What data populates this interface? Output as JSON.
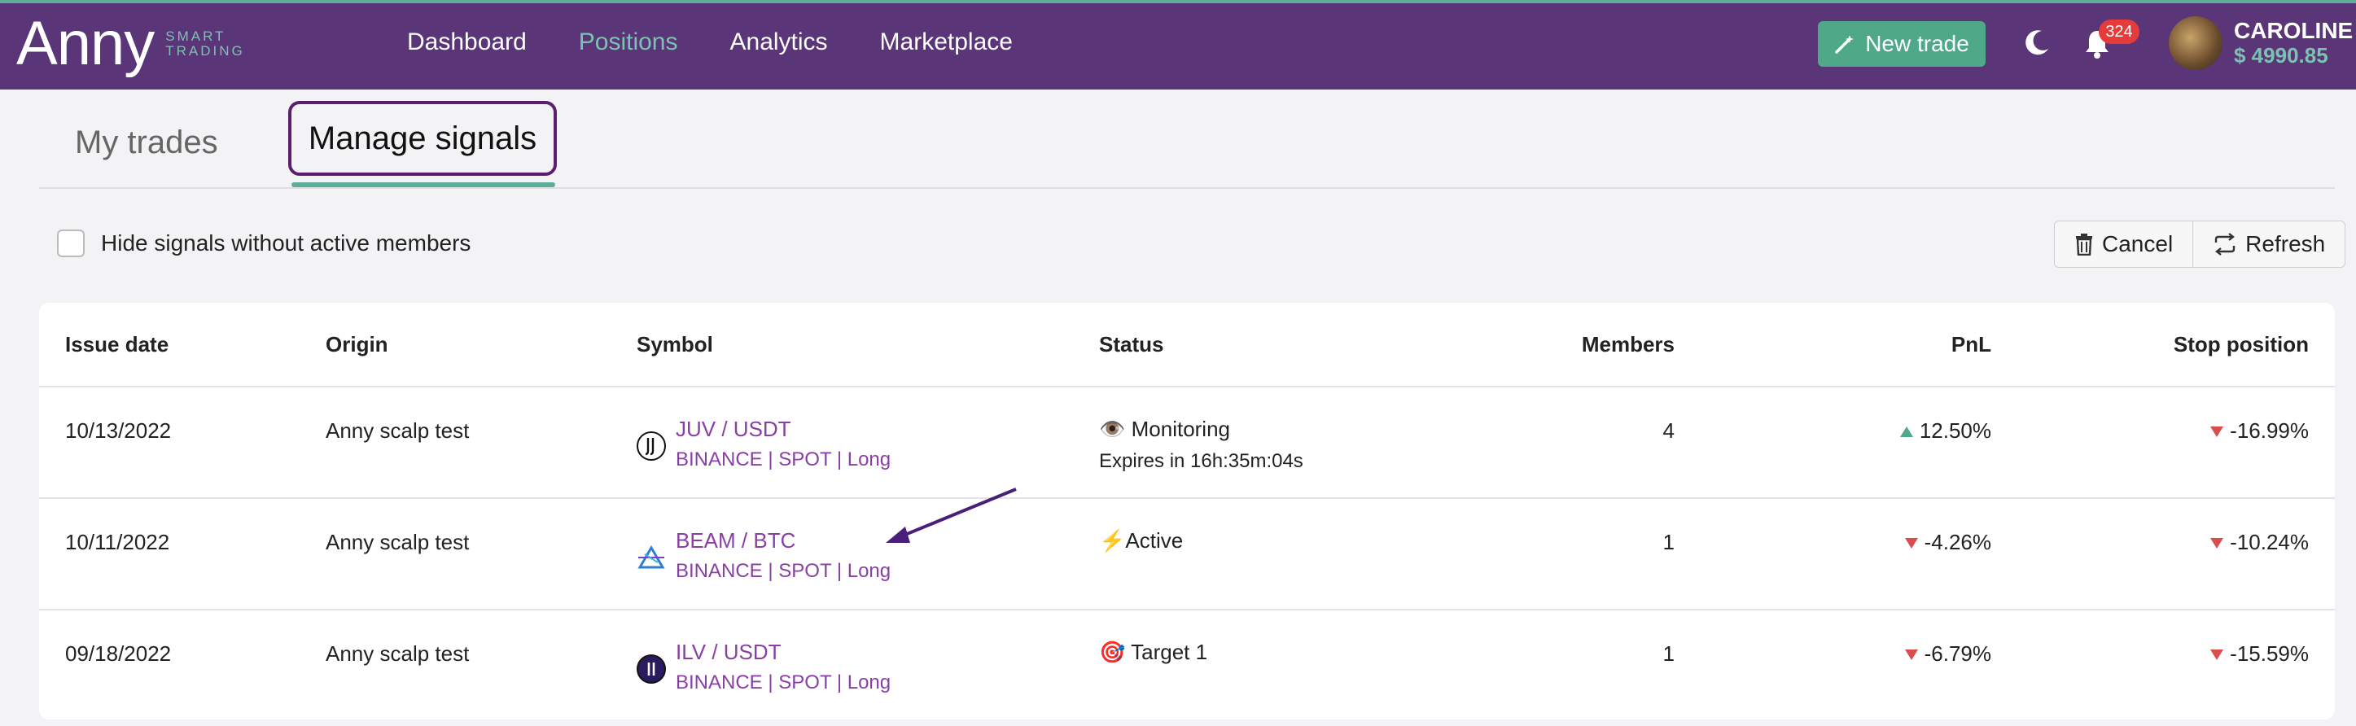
{
  "header": {
    "logo_main": "Anny",
    "logo_sub_1": "Smart",
    "logo_sub_2": "Trading",
    "nav": [
      {
        "label": "Dashboard",
        "active": false
      },
      {
        "label": "Positions",
        "active": true
      },
      {
        "label": "Analytics",
        "active": false
      },
      {
        "label": "Marketplace",
        "active": false
      }
    ],
    "new_trade_label": "New trade",
    "notification_count": "324",
    "user_name": "CAROLINE",
    "user_balance": "$ 4990.85"
  },
  "tabs": [
    {
      "label": "My trades",
      "active": false
    },
    {
      "label": "Manage signals",
      "active": true
    }
  ],
  "filter": {
    "hide_label": "Hide signals without active members",
    "checked": false
  },
  "actions": {
    "cancel_label": "Cancel",
    "refresh_label": "Refresh"
  },
  "table": {
    "headers": {
      "issue_date": "Issue date",
      "origin": "Origin",
      "symbol": "Symbol",
      "status": "Status",
      "members": "Members",
      "pnl": "PnL",
      "stop_position": "Stop position"
    },
    "rows": [
      {
        "issue_date": "10/13/2022",
        "origin": "Anny scalp test",
        "symbol": "JUV / USDT",
        "symbol_sub": "BINANCE | SPOT | Long",
        "symbol_icon": "juventus-icon",
        "status_icon": "eye-icon",
        "status_icon_glyph": "👁️",
        "status": "Monitoring",
        "status_sub": "Expires in 16h:35m:04s",
        "members": "4",
        "pnl": "12.50%",
        "pnl_direction": "up",
        "stop_position": "-16.99%"
      },
      {
        "issue_date": "10/11/2022",
        "origin": "Anny scalp test",
        "symbol": "BEAM / BTC",
        "symbol_sub": "BINANCE | SPOT | Long",
        "symbol_icon": "beam-icon",
        "status_icon": "lightning-icon",
        "status_icon_glyph": "⚡",
        "status": "Active",
        "status_sub": "",
        "members": "1",
        "pnl": "-4.26%",
        "pnl_direction": "down",
        "stop_position": "-10.24%"
      },
      {
        "issue_date": "09/18/2022",
        "origin": "Anny scalp test",
        "symbol": "ILV / USDT",
        "symbol_sub": "BINANCE | SPOT | Long",
        "symbol_icon": "illuvium-icon",
        "status_icon": "target-icon",
        "status_icon_glyph": "🎯",
        "status": "Target 1",
        "status_sub": "",
        "members": "1",
        "pnl": "-6.79%",
        "pnl_direction": "down",
        "stop_position": "-15.59%"
      }
    ]
  },
  "colors": {
    "topbar": "#5a3578",
    "accent_green": "#4fa888",
    "link_purple": "#8a3fa5",
    "negative_red": "#d94d4d"
  }
}
